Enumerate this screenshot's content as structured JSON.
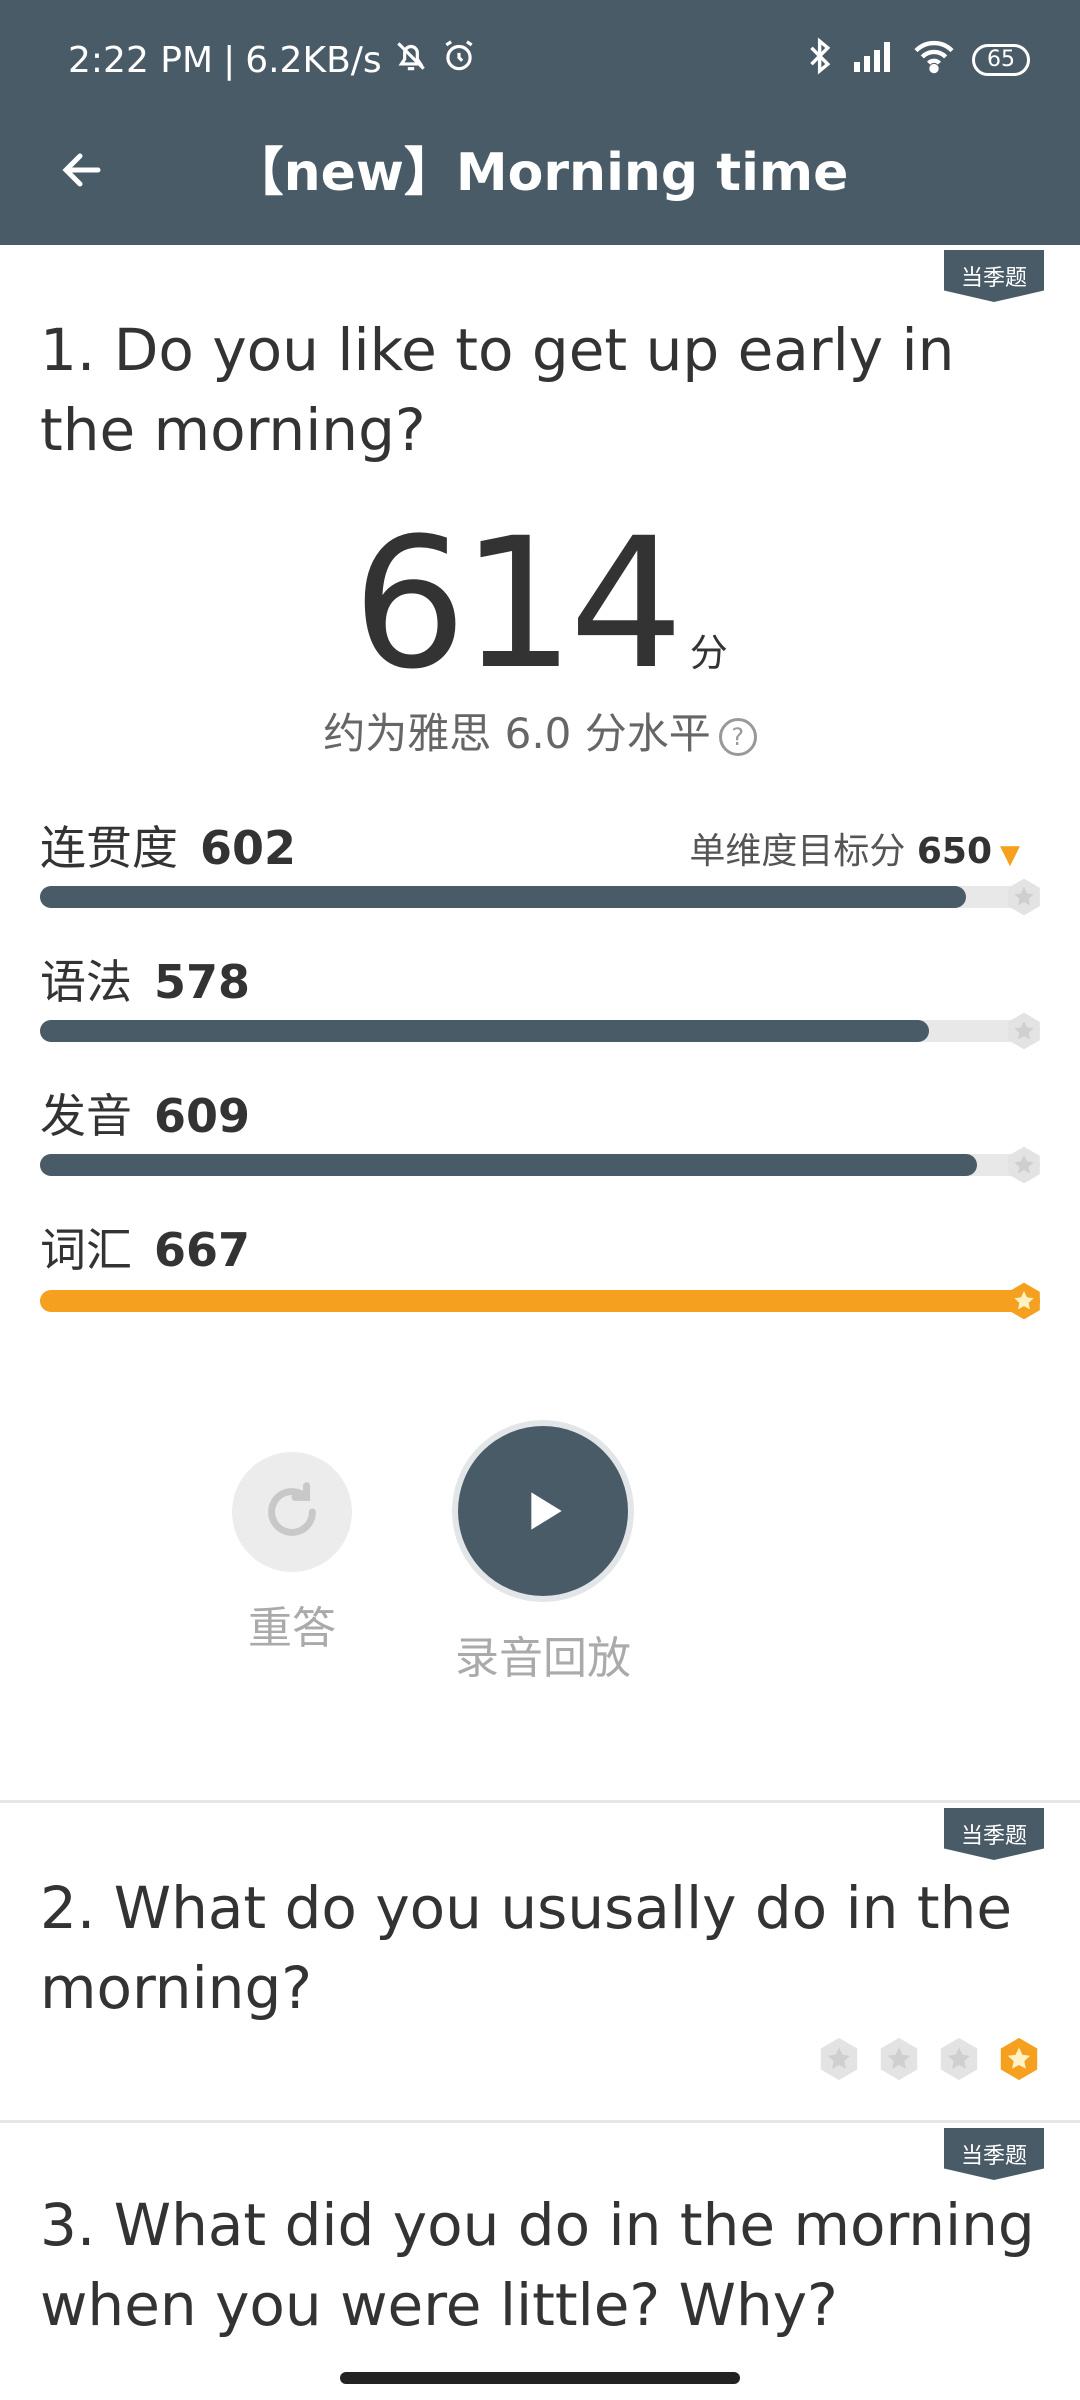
{
  "status_bar": {
    "time": "2:22 PM",
    "speed": "6.2KB/s",
    "battery": "65"
  },
  "header": {
    "title": "【new】Morning time"
  },
  "season_tag": "当季题",
  "questions": [
    {
      "text": "1. Do you like to get up early in the morning?"
    },
    {
      "text": "2. What do you ususally do in the morning?"
    },
    {
      "text": "3. What did you do in the morning when you were little? Why?"
    }
  ],
  "score": {
    "value": "614",
    "unit": "分",
    "ielts_text": "约为雅思 6.0 分水平",
    "help": "?"
  },
  "dimensions": [
    {
      "label": "连贯度",
      "value": "602",
      "ratio": 0.926,
      "color": "#4a5b68",
      "achieved": false
    },
    {
      "label": "语法",
      "value": "578",
      "ratio": 0.889,
      "color": "#4a5b68",
      "achieved": false
    },
    {
      "label": "发音",
      "value": "609",
      "ratio": 0.937,
      "color": "#4a5b68",
      "achieved": false
    },
    {
      "label": "词汇",
      "value": "667",
      "ratio": 1.0,
      "color": "#f5a01f",
      "achieved": true
    }
  ],
  "target": {
    "label": "单维度目标分",
    "value": "650"
  },
  "controls": {
    "redo_label": "重答",
    "play_label": "录音回放"
  },
  "q2_stars": {
    "total": 4,
    "achieved": 1
  },
  "colors": {
    "header_bg": "#4a5b68",
    "accent": "#f5a01f",
    "track": "#e8e8e8"
  }
}
